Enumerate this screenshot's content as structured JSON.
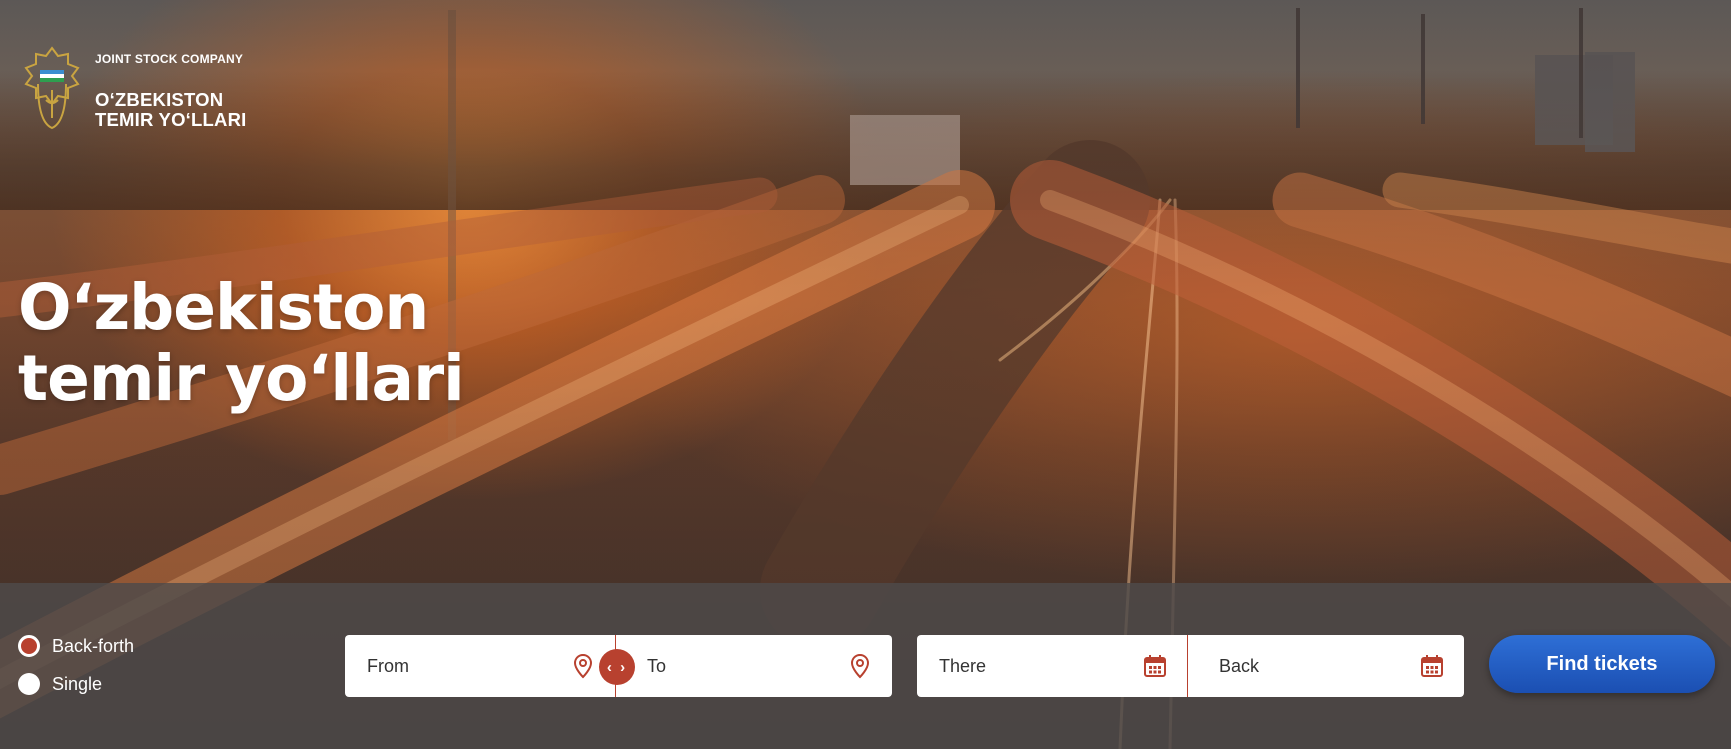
{
  "brand": {
    "tagline": "JOINT STOCK COMPANY",
    "name_line1": "O‘ZBEKISTON",
    "name_line2": "TEMIR YO‘LLARI",
    "logo_icon": "uzbekistan-railways-emblem-icon"
  },
  "hero": {
    "title_line1": "O‘zbekiston",
    "title_line2": "temir yo‘llari"
  },
  "search": {
    "trip_types": [
      {
        "label": "Back-forth",
        "selected": true
      },
      {
        "label": "Single",
        "selected": false
      }
    ],
    "from_label": "From",
    "to_label": "To",
    "there_label": "There",
    "back_label": "Back",
    "swap_label": "‹ ›",
    "find_button": "Find tickets",
    "location_icon": "map-pin-icon",
    "calendar_icon": "calendar-icon"
  },
  "colors": {
    "accent": "#b8412f",
    "button": "#1f56bd",
    "bar": "#4e4a4a"
  }
}
